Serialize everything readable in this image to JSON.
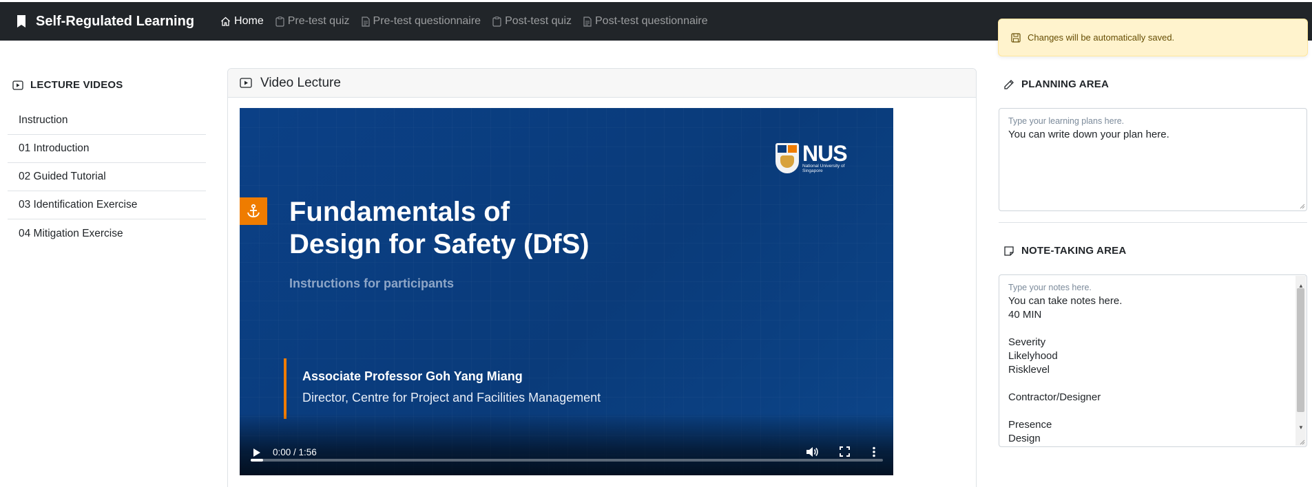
{
  "navbar": {
    "brand": "Self-Regulated Learning",
    "links": [
      {
        "label": "Home",
        "icon": "home-icon"
      },
      {
        "label": "Pre-test quiz",
        "icon": "clipboard-icon"
      },
      {
        "label": "Pre-test questionnaire",
        "icon": "document-icon"
      },
      {
        "label": "Post-test quiz",
        "icon": "clipboard-icon"
      },
      {
        "label": "Post-test questionnaire",
        "icon": "document-icon"
      }
    ]
  },
  "toast": {
    "message": "Changes will be automatically saved.",
    "icon": "save-icon"
  },
  "sidebar": {
    "title": "LECTURE VIDEOS",
    "items": [
      {
        "label": "Instruction"
      },
      {
        "label": "01 Introduction"
      },
      {
        "label": "02 Guided Tutorial"
      },
      {
        "label": "03 Identification Exercise"
      },
      {
        "label": "04 Mitigation Exercise"
      }
    ]
  },
  "main": {
    "card_title": "Video Lecture",
    "video": {
      "logo_text": "NUS",
      "logo_subtext": "National University of Singapore",
      "title_line1": "Fundamentals of",
      "title_line2": "Design for Safety (DfS)",
      "subtitle": "Instructions for participants",
      "presenter": "Associate Professor Goh Yang Miang",
      "role": "Director, Centre for Project and Facilities Management",
      "time": "0:00 / 1:56",
      "progress": 0.0
    }
  },
  "planning": {
    "title": "PLANNING AREA",
    "placeholder": "Type your learning plans here.",
    "value": "You can write down your plan here."
  },
  "notes": {
    "title": "NOTE-TAKING AREA",
    "placeholder": "Type your notes here.",
    "lines": [
      "You can take notes here.",
      "40 MIN",
      "",
      "Severity",
      "Likelyhood",
      "Risklevel",
      "",
      "Contractor/Designer",
      "",
      "Presence",
      "Design"
    ]
  },
  "colors": {
    "navbar": "#212529",
    "toast_bg": "#fff3cd",
    "accent_orange": "#ef7c00",
    "video_blue": "#0a3d7e"
  }
}
